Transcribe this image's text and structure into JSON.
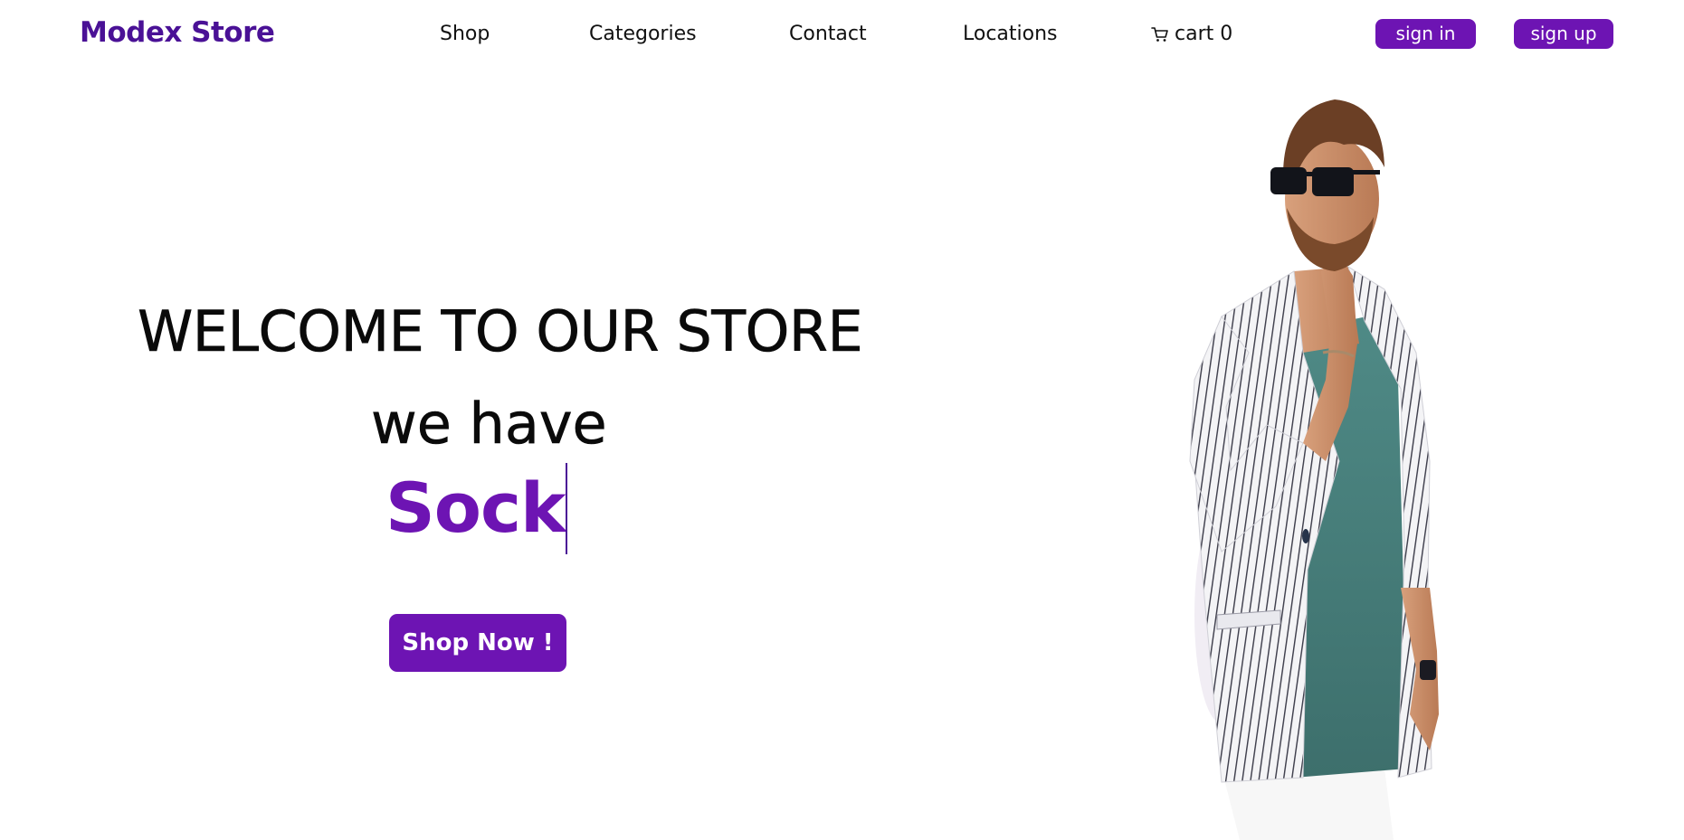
{
  "brand": {
    "name": "Modex Store",
    "color": "#4a1196"
  },
  "nav": {
    "items": [
      {
        "label": "Shop"
      },
      {
        "label": "Categories"
      },
      {
        "label": "Contact"
      },
      {
        "label": "Locations"
      }
    ],
    "cart": {
      "icon": "cart-icon",
      "label": "cart",
      "count": "0"
    }
  },
  "auth": {
    "sign_in": "sign in",
    "sign_up": "sign up",
    "button_color": "#6d14b3"
  },
  "hero": {
    "title": "WELCOME TO OUR STORE",
    "subtitle": "we have",
    "typed_word": "Sock",
    "accent_color": "#6d14b3",
    "cta_label": "Shop Now !"
  }
}
